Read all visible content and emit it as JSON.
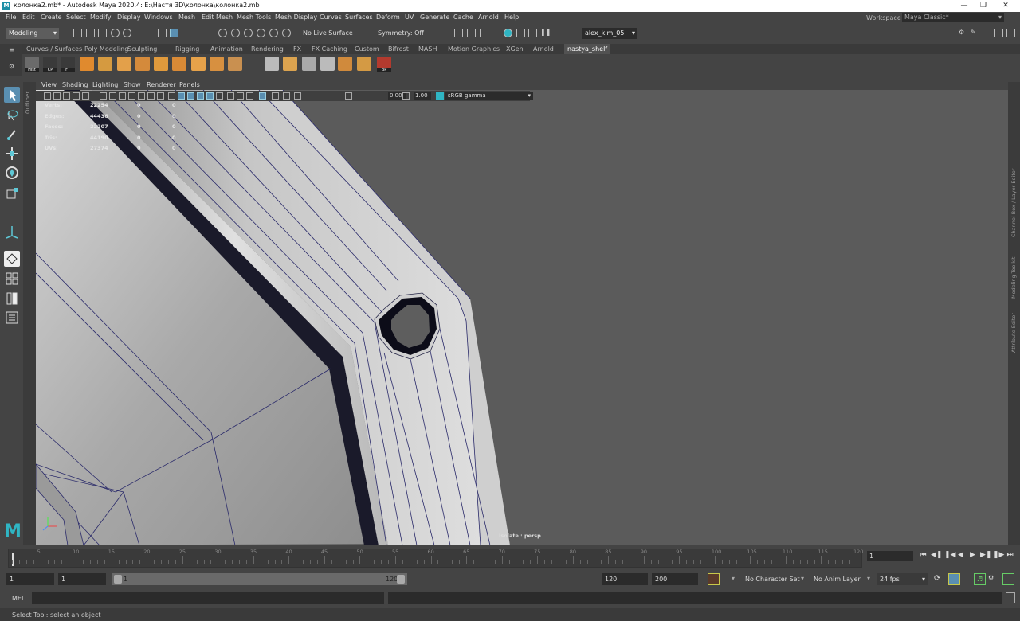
{
  "window": {
    "title": "колонка2.mb* - Autodesk Maya 2020.4: E:\\Настя 3D\\колонка\\колонка2.mb",
    "logo_letter": "M"
  },
  "menu": [
    "File",
    "Edit",
    "Create",
    "Select",
    "Modify",
    "Display",
    "Windows",
    "Mesh",
    "Edit Mesh",
    "Mesh Tools",
    "Mesh Display",
    "Curves",
    "Surfaces",
    "Deform",
    "UV",
    "Generate",
    "Cache",
    "Arnold",
    "Help"
  ],
  "workspace": {
    "label": "Workspace :",
    "value": "Maya Classic*"
  },
  "status_line": {
    "mode": "Modeling",
    "live_surface": "No Live Surface",
    "symmetry": "Symmetry: Off",
    "user": "alex_kim_05"
  },
  "shelf_tabs": [
    "Curves / Surfaces",
    "Poly Modeling",
    "Sculpting",
    "Rigging",
    "Animation",
    "Rendering",
    "FX",
    "FX Caching",
    "Custom",
    "Bifrost",
    "MASH",
    "Motion Graphics",
    "XGen",
    "Arnold",
    "nastya_shelf"
  ],
  "shelf_active": "nastya_shelf",
  "shelf_buttons": [
    {
      "name": "hist-icon",
      "label": "Hist",
      "color": "#6b6b6b"
    },
    {
      "name": "cp-icon",
      "label": "CP",
      "color": "#3a3a3a"
    },
    {
      "name": "ft-icon",
      "label": "FT",
      "color": "#3a3a3a"
    },
    {
      "name": "bevel-icon",
      "label": "",
      "color": "#e08a2e"
    },
    {
      "name": "sphere-icon",
      "label": "",
      "color": "#d59a40"
    },
    {
      "name": "diamond-icon",
      "label": "",
      "color": "#e3a04a"
    },
    {
      "name": "extrude-icon",
      "label": "",
      "color": "#d48a3b"
    },
    {
      "name": "cube-icon",
      "label": "",
      "color": "#e09a3c"
    },
    {
      "name": "bridge-icon",
      "label": "",
      "color": "#d98a36"
    },
    {
      "name": "merge-icon",
      "label": "",
      "color": "#e6a24a"
    },
    {
      "name": "split-icon",
      "label": "",
      "color": "#d79040"
    },
    {
      "name": "combine-icon",
      "label": "",
      "color": "#c99050"
    },
    {
      "name": "separate-icon",
      "label": "",
      "color": "#bbbbbb"
    },
    {
      "name": "knife-icon",
      "label": "",
      "color": "#dba34f"
    },
    {
      "name": "grid-icon",
      "label": "",
      "color": "#aaaaaa"
    },
    {
      "name": "multicut-icon",
      "label": "",
      "color": "#bbbbbb"
    },
    {
      "name": "fill-icon",
      "label": "",
      "color": "#d08a3c"
    },
    {
      "name": "duplicate-icon",
      "label": "",
      "color": "#d49a44"
    },
    {
      "name": "bp-icon",
      "label": "BP",
      "color": "#b33a2e"
    }
  ],
  "outliner_label": "Outliner",
  "viewport": {
    "menu": [
      "View",
      "Shading",
      "Lighting",
      "Show",
      "Renderer",
      "Panels"
    ],
    "exposure": "0.00",
    "gamma": "1.00",
    "color_space": "sRGB gamma",
    "camera": "Isolate : persp"
  },
  "hud": [
    {
      "label": "Verts:",
      "value": "22254",
      "sel": "0",
      "comp": "0"
    },
    {
      "label": "Edges:",
      "value": "44436",
      "sel": "0",
      "comp": "0"
    },
    {
      "label": "Faces:",
      "value": "22207",
      "sel": "0",
      "comp": "0"
    },
    {
      "label": "Tris:",
      "value": "44190",
      "sel": "0",
      "comp": "0"
    },
    {
      "label": "UVs:",
      "value": "27374",
      "sel": "0",
      "comp": "0"
    }
  ],
  "right_panels": [
    "Channel Box / Layer Editor",
    "Modeling Toolkit",
    "Attribute Editor"
  ],
  "timeline": {
    "ticks": [
      "5",
      "10",
      "15",
      "20",
      "25",
      "30",
      "35",
      "40",
      "45",
      "50",
      "55",
      "60",
      "65",
      "70",
      "75",
      "80",
      "85",
      "90",
      "95",
      "100",
      "105",
      "110",
      "115",
      "120"
    ],
    "current_frame": "1"
  },
  "range": {
    "start": "1",
    "playback_start": "1",
    "slider_start": "1",
    "slider_end": "120",
    "playback_end": "120",
    "end": "200",
    "character_set": "No Character Set",
    "anim_layer": "No Anim Layer",
    "fps": "24 fps"
  },
  "command": {
    "lang": "MEL"
  },
  "help_line": "Select Tool: select an object"
}
